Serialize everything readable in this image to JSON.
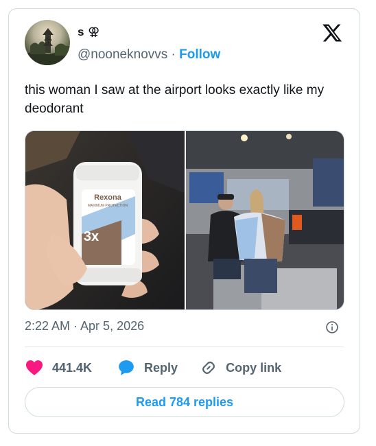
{
  "author": {
    "display_name": "s ⚢",
    "handle": "@nooneknovvs",
    "separator": " · ",
    "follow_label": "Follow"
  },
  "tweet": {
    "text": "this woman I saw at the airport looks exactly like my deodorant",
    "timestamp": "2:22 AM · Apr 5, 2026"
  },
  "media": {
    "left_photo": {
      "brand": "Rexona",
      "sub": "MAXIMUM PROTECTION",
      "badge": "3x"
    },
    "right_photo": {}
  },
  "actions": {
    "like_count": "441.4K",
    "reply_label": "Reply",
    "copy_link_label": "Copy link"
  },
  "read_replies_label": "Read 784 replies",
  "colors": {
    "accent": "#1d9bf0",
    "heart": "#f91880",
    "text": "#0f1419",
    "secondary": "#536471"
  },
  "icons": [
    "x-logo-icon",
    "info-icon",
    "heart-icon",
    "reply-bubble-icon",
    "link-icon"
  ]
}
